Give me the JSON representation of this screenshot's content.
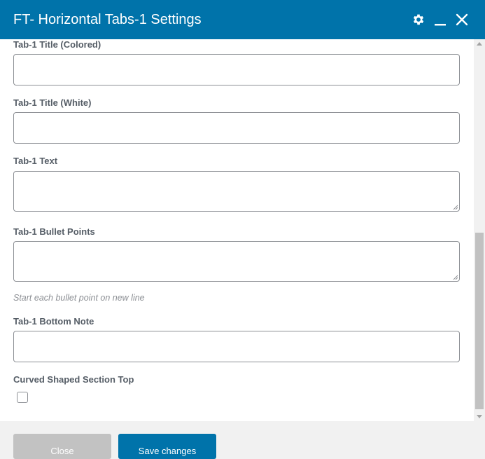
{
  "window": {
    "title": "FT- Horizontal Tabs-1 Settings",
    "icons": [
      "gear-icon",
      "minimize-icon",
      "close-icon"
    ]
  },
  "fields": {
    "title_colored": {
      "label": "Tab-1 Title (Colored)",
      "value": ""
    },
    "title_white": {
      "label": "Tab-1 Title (White)",
      "value": ""
    },
    "text": {
      "label": "Tab-1 Text",
      "value": ""
    },
    "bullets": {
      "label": "Tab-1 Bullet Points",
      "value": "",
      "help": "Start each bullet point on new line"
    },
    "bottom_note": {
      "label": "Tab-1 Bottom Note",
      "value": ""
    },
    "curved_top": {
      "label": "Curved Shaped Section Top",
      "checked": false
    }
  },
  "footer": {
    "close_label": "Close",
    "save_label": "Save changes"
  },
  "colors": {
    "header_bg": "#0073aa",
    "primary_button": "#0073aa",
    "disabled_button": "#c2c2c2"
  }
}
